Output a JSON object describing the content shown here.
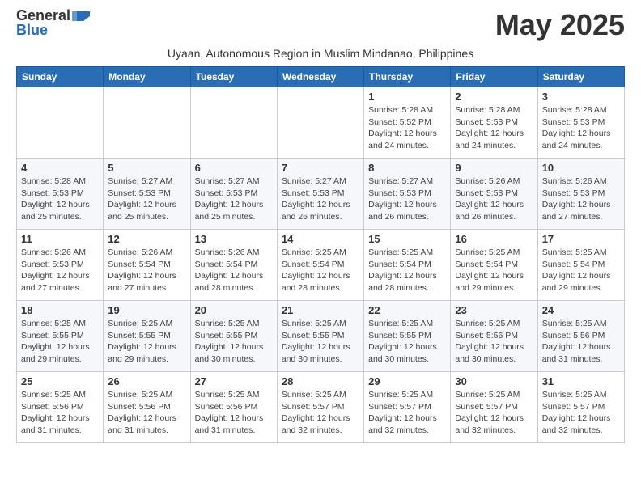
{
  "logo": {
    "general": "General",
    "blue": "Blue"
  },
  "title": "May 2025",
  "subtitle": "Uyaan, Autonomous Region in Muslim Mindanao, Philippines",
  "headers": [
    "Sunday",
    "Monday",
    "Tuesday",
    "Wednesday",
    "Thursday",
    "Friday",
    "Saturday"
  ],
  "weeks": [
    [
      {
        "day": "",
        "info": ""
      },
      {
        "day": "",
        "info": ""
      },
      {
        "day": "",
        "info": ""
      },
      {
        "day": "",
        "info": ""
      },
      {
        "day": "1",
        "info": "Sunrise: 5:28 AM\nSunset: 5:52 PM\nDaylight: 12 hours and 24 minutes."
      },
      {
        "day": "2",
        "info": "Sunrise: 5:28 AM\nSunset: 5:53 PM\nDaylight: 12 hours and 24 minutes."
      },
      {
        "day": "3",
        "info": "Sunrise: 5:28 AM\nSunset: 5:53 PM\nDaylight: 12 hours and 24 minutes."
      }
    ],
    [
      {
        "day": "4",
        "info": "Sunrise: 5:28 AM\nSunset: 5:53 PM\nDaylight: 12 hours and 25 minutes."
      },
      {
        "day": "5",
        "info": "Sunrise: 5:27 AM\nSunset: 5:53 PM\nDaylight: 12 hours and 25 minutes."
      },
      {
        "day": "6",
        "info": "Sunrise: 5:27 AM\nSunset: 5:53 PM\nDaylight: 12 hours and 25 minutes."
      },
      {
        "day": "7",
        "info": "Sunrise: 5:27 AM\nSunset: 5:53 PM\nDaylight: 12 hours and 26 minutes."
      },
      {
        "day": "8",
        "info": "Sunrise: 5:27 AM\nSunset: 5:53 PM\nDaylight: 12 hours and 26 minutes."
      },
      {
        "day": "9",
        "info": "Sunrise: 5:26 AM\nSunset: 5:53 PM\nDaylight: 12 hours and 26 minutes."
      },
      {
        "day": "10",
        "info": "Sunrise: 5:26 AM\nSunset: 5:53 PM\nDaylight: 12 hours and 27 minutes."
      }
    ],
    [
      {
        "day": "11",
        "info": "Sunrise: 5:26 AM\nSunset: 5:53 PM\nDaylight: 12 hours and 27 minutes."
      },
      {
        "day": "12",
        "info": "Sunrise: 5:26 AM\nSunset: 5:54 PM\nDaylight: 12 hours and 27 minutes."
      },
      {
        "day": "13",
        "info": "Sunrise: 5:26 AM\nSunset: 5:54 PM\nDaylight: 12 hours and 28 minutes."
      },
      {
        "day": "14",
        "info": "Sunrise: 5:25 AM\nSunset: 5:54 PM\nDaylight: 12 hours and 28 minutes."
      },
      {
        "day": "15",
        "info": "Sunrise: 5:25 AM\nSunset: 5:54 PM\nDaylight: 12 hours and 28 minutes."
      },
      {
        "day": "16",
        "info": "Sunrise: 5:25 AM\nSunset: 5:54 PM\nDaylight: 12 hours and 29 minutes."
      },
      {
        "day": "17",
        "info": "Sunrise: 5:25 AM\nSunset: 5:54 PM\nDaylight: 12 hours and 29 minutes."
      }
    ],
    [
      {
        "day": "18",
        "info": "Sunrise: 5:25 AM\nSunset: 5:55 PM\nDaylight: 12 hours and 29 minutes."
      },
      {
        "day": "19",
        "info": "Sunrise: 5:25 AM\nSunset: 5:55 PM\nDaylight: 12 hours and 29 minutes."
      },
      {
        "day": "20",
        "info": "Sunrise: 5:25 AM\nSunset: 5:55 PM\nDaylight: 12 hours and 30 minutes."
      },
      {
        "day": "21",
        "info": "Sunrise: 5:25 AM\nSunset: 5:55 PM\nDaylight: 12 hours and 30 minutes."
      },
      {
        "day": "22",
        "info": "Sunrise: 5:25 AM\nSunset: 5:55 PM\nDaylight: 12 hours and 30 minutes."
      },
      {
        "day": "23",
        "info": "Sunrise: 5:25 AM\nSunset: 5:56 PM\nDaylight: 12 hours and 30 minutes."
      },
      {
        "day": "24",
        "info": "Sunrise: 5:25 AM\nSunset: 5:56 PM\nDaylight: 12 hours and 31 minutes."
      }
    ],
    [
      {
        "day": "25",
        "info": "Sunrise: 5:25 AM\nSunset: 5:56 PM\nDaylight: 12 hours and 31 minutes."
      },
      {
        "day": "26",
        "info": "Sunrise: 5:25 AM\nSunset: 5:56 PM\nDaylight: 12 hours and 31 minutes."
      },
      {
        "day": "27",
        "info": "Sunrise: 5:25 AM\nSunset: 5:56 PM\nDaylight: 12 hours and 31 minutes."
      },
      {
        "day": "28",
        "info": "Sunrise: 5:25 AM\nSunset: 5:57 PM\nDaylight: 12 hours and 32 minutes."
      },
      {
        "day": "29",
        "info": "Sunrise: 5:25 AM\nSunset: 5:57 PM\nDaylight: 12 hours and 32 minutes."
      },
      {
        "day": "30",
        "info": "Sunrise: 5:25 AM\nSunset: 5:57 PM\nDaylight: 12 hours and 32 minutes."
      },
      {
        "day": "31",
        "info": "Sunrise: 5:25 AM\nSunset: 5:57 PM\nDaylight: 12 hours and 32 minutes."
      }
    ]
  ]
}
